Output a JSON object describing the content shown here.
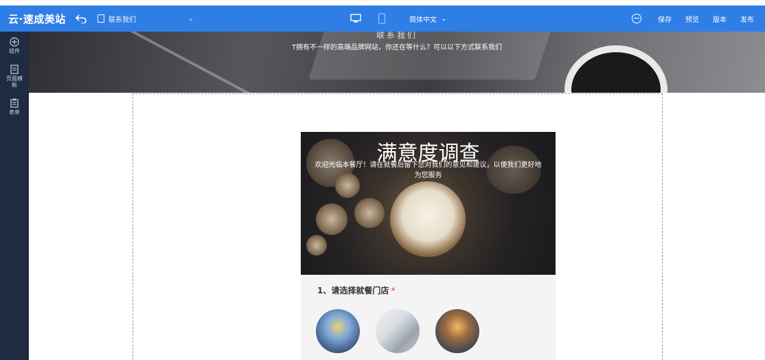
{
  "toolbar": {
    "logo": "云·速成美站",
    "page_select_label": "联系我们",
    "language": "简体中文",
    "actions": [
      "保存",
      "预览",
      "版本",
      "发布"
    ]
  },
  "sidebar": {
    "items": [
      {
        "label": "组件",
        "icon": "plus-circle-icon"
      },
      {
        "label": "页面模板",
        "icon": "page-icon"
      },
      {
        "label": "表单",
        "icon": "form-icon"
      }
    ]
  },
  "hero": {
    "title_partial": "联系我们",
    "subtitle": "T拥有不一样的高端品牌网站，你还在等什么？可以以下方式联系我们"
  },
  "survey": {
    "title": "满意度调查",
    "description": "欢迎光临本餐厅！请在就餐后留下您对我们的意见和建议，以便我们更好地为您服务",
    "question1": {
      "label": "1、请选择就餐门店",
      "required_mark": "*"
    },
    "stores": [
      "store-1",
      "store-2",
      "store-3"
    ]
  },
  "colors": {
    "toolbar": "#2f7ee6",
    "sidebar": "#1f2b41",
    "required": "#e03b3b"
  }
}
